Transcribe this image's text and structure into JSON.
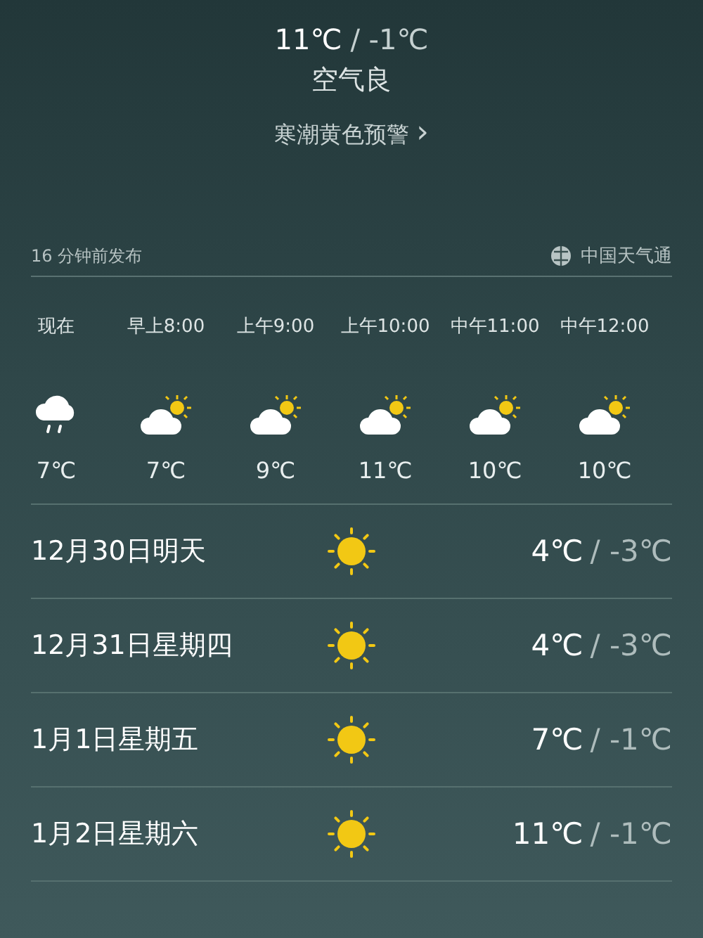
{
  "today": {
    "high": "11℃",
    "low": "/ -1℃",
    "air_quality": "空气良",
    "alert": "寒潮黄色预警",
    "alert_chevron": "›"
  },
  "source": {
    "published": "16 分钟前发布",
    "provider": "中国天气通"
  },
  "hourly": [
    {
      "time": "现在",
      "kind": "rain",
      "temp": "7℃"
    },
    {
      "time": "早上8:00",
      "kind": "partly_cloudy",
      "temp": "7℃"
    },
    {
      "time": "上午9:00",
      "kind": "partly_cloudy",
      "temp": "9℃"
    },
    {
      "time": "上午10:00",
      "kind": "partly_cloudy",
      "temp": "11℃"
    },
    {
      "time": "中午11:00",
      "kind": "partly_cloudy",
      "temp": "10℃"
    },
    {
      "time": "中午12:00",
      "kind": "partly_cloudy",
      "temp": "10℃"
    }
  ],
  "daily": [
    {
      "date": "12月30日明天",
      "kind": "sunny",
      "high": "4℃",
      "low": "/ -3℃"
    },
    {
      "date": "12月31日星期四",
      "kind": "sunny",
      "high": "4℃",
      "low": "/ -3℃"
    },
    {
      "date": "1月1日星期五",
      "kind": "sunny",
      "high": "7℃",
      "low": "/ -1℃"
    },
    {
      "date": "1月2日星期六",
      "kind": "sunny",
      "high": "11℃",
      "low": "/ -1℃"
    }
  ]
}
